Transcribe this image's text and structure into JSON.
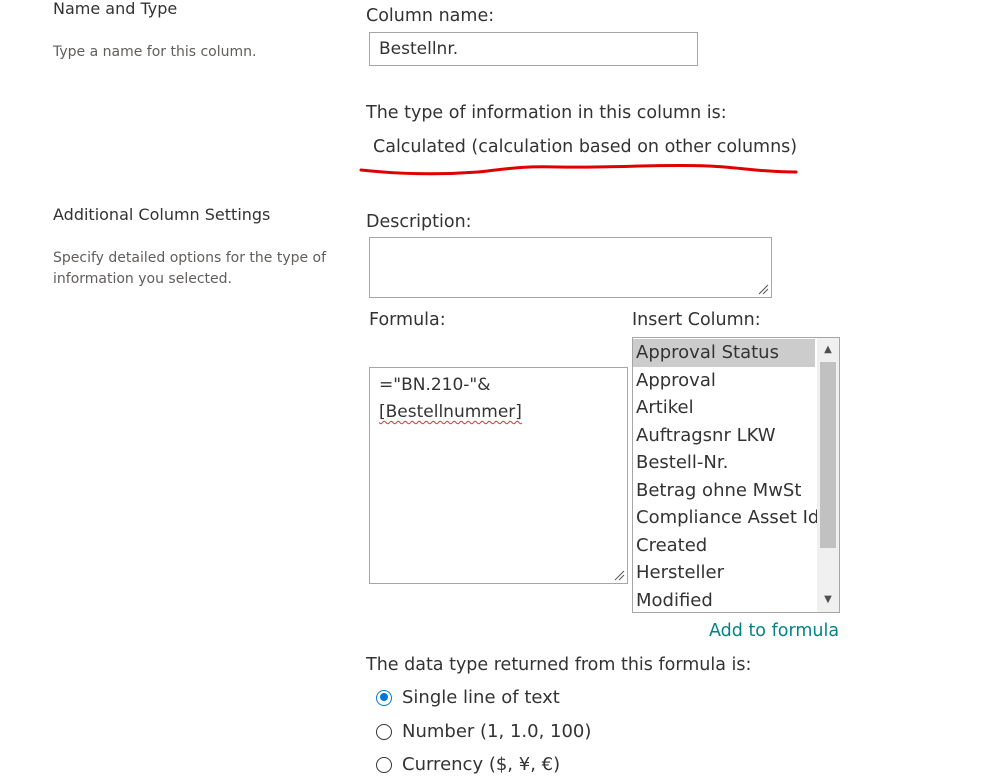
{
  "name_and_type": {
    "title": "Name and Type",
    "description": "Type a name for this column."
  },
  "column_name": {
    "label": "Column name:",
    "value": "Bestellnr."
  },
  "info_type": {
    "label": "The type of information in this column is:",
    "value": "Calculated (calculation based on other columns)",
    "annotation_color": "#e00000"
  },
  "additional_settings": {
    "title": "Additional Column Settings",
    "description": "Specify detailed options for the type of information you selected."
  },
  "description_field": {
    "label": "Description:",
    "value": ""
  },
  "formula": {
    "label": "Formula:",
    "line1": "=\"BN.210-\"&",
    "line2": "[Bestellnummer]"
  },
  "insert_column": {
    "label": "Insert Column:",
    "items": [
      "Approval Status",
      "Approval",
      "Artikel",
      "Auftragsnr LKW",
      "Bestell-Nr.",
      "Betrag ohne MwSt",
      "Compliance Asset Id",
      "Created",
      "Hersteller",
      "Modified"
    ],
    "selected_index": 0,
    "add_link": "Add to formula"
  },
  "return_type": {
    "label": "The data type returned from this formula is:",
    "options": [
      {
        "label": "Single line of text",
        "checked": true
      },
      {
        "label": "Number (1, 1.0, 100)",
        "checked": false
      },
      {
        "label": "Currency ($, ¥, €)",
        "checked": false
      }
    ]
  },
  "colors": {
    "accent": "#0078d4",
    "link": "#038387",
    "annotation": "#e00000"
  }
}
